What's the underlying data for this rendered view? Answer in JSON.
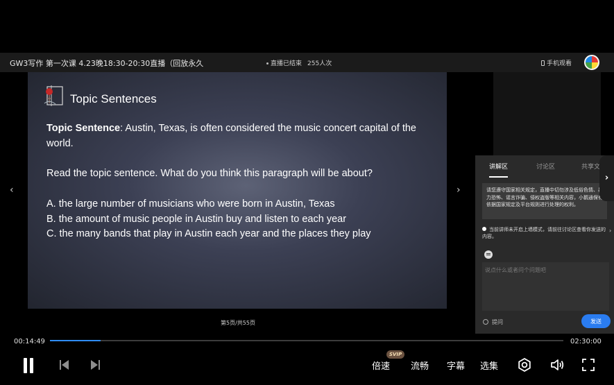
{
  "header": {
    "title": "GW3写作 第一次课 4.23晚18:30-20:30直播（回放永久",
    "status": "直播已结束",
    "viewers": "255人次",
    "mobile_label": "手机观看"
  },
  "slide": {
    "title": "Topic Sentences",
    "topic_label": "Topic Sentence",
    "topic_text": ": Austin, Texas, is often considered the music concert capital of the world.",
    "question": "Read the topic sentence. What do you think this paragraph will be about?",
    "options": [
      "A. the large number of musicians who were born in Austin, Texas",
      "B. the amount of music people in Austin buy and listen to each year",
      "C. the many bands that play in Austin each year and the places they play"
    ],
    "page_indicator": "第5页/共55页"
  },
  "chat": {
    "tabs": [
      "讲解区",
      "讨论区",
      "共享文件"
    ],
    "notice": "请您遵守国家相关规定，直播中切勿涉及低俗色情、暴力恐怖、谣言诈骗、侵权盗版等相关内容，小鹅通保有依据国家规定及平台规则进行处理的权利。",
    "mode_note": "当前讲师未开启上墙模式，请前往讨论区查看你发送的内容。",
    "input_placeholder": "说点什么或者问个问题吧",
    "ask_label": "提问",
    "send_label": "发送"
  },
  "player": {
    "current_time": "00:14:49",
    "duration": "02:30:00",
    "progress": 0.0988,
    "speed_label": "倍速",
    "quality_label": "流畅",
    "subtitle_label": "字幕",
    "episodes_label": "选集",
    "svip_badge": "SVIP"
  },
  "colors": {
    "accent": "#2f8cf5",
    "send_button": "#2a7cf0",
    "panel_bg": "#2a2a2a"
  },
  "icons": [
    "pause-icon",
    "previous-icon",
    "next-icon",
    "settings-icon",
    "volume-icon",
    "fullscreen-icon",
    "chevron-left-icon",
    "chevron-right-icon",
    "close-icon",
    "phone-icon",
    "emoji-icon"
  ]
}
